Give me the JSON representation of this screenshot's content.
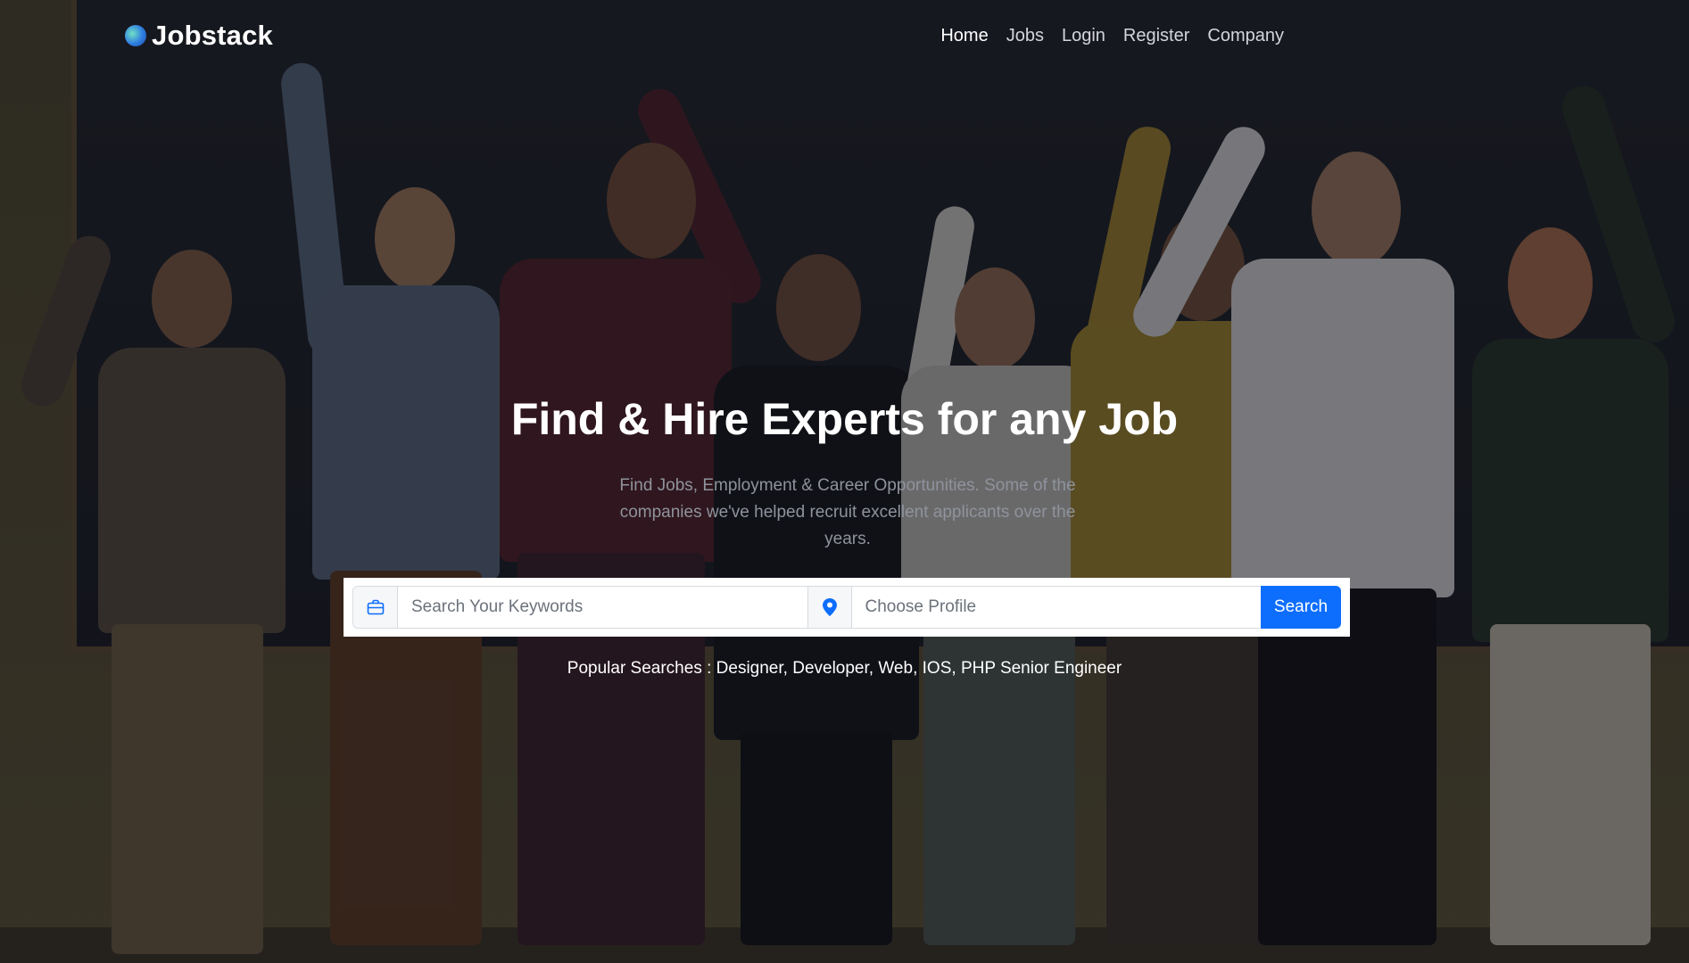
{
  "brand": {
    "name": "Jobstack"
  },
  "nav": {
    "items": [
      {
        "label": "Home",
        "active": true
      },
      {
        "label": "Jobs",
        "active": false
      },
      {
        "label": "Login",
        "active": false
      },
      {
        "label": "Register",
        "active": false
      },
      {
        "label": "Company",
        "active": false
      }
    ]
  },
  "hero": {
    "title": "Find & Hire Experts for any Job",
    "subtitle": "Find Jobs, Employment & Career Opportunities. Some of the companies we've helped recruit excellent applicants over the years."
  },
  "search": {
    "keyword_placeholder": "Search Your Keywords",
    "keyword_value": "",
    "keyword_icon": "briefcase-icon",
    "profile_placeholder": "Choose Profile",
    "profile_value": "",
    "profile_icon": "map-pin-icon",
    "button_label": "Search"
  },
  "popular": {
    "label": "Popular Searches :",
    "items": [
      "Designer",
      "Developer",
      "Web",
      "IOS",
      "PHP Senior Engineer"
    ]
  },
  "colors": {
    "primary": "#0d6efd",
    "overlay": "rgba(10,12,18,0.45)"
  }
}
